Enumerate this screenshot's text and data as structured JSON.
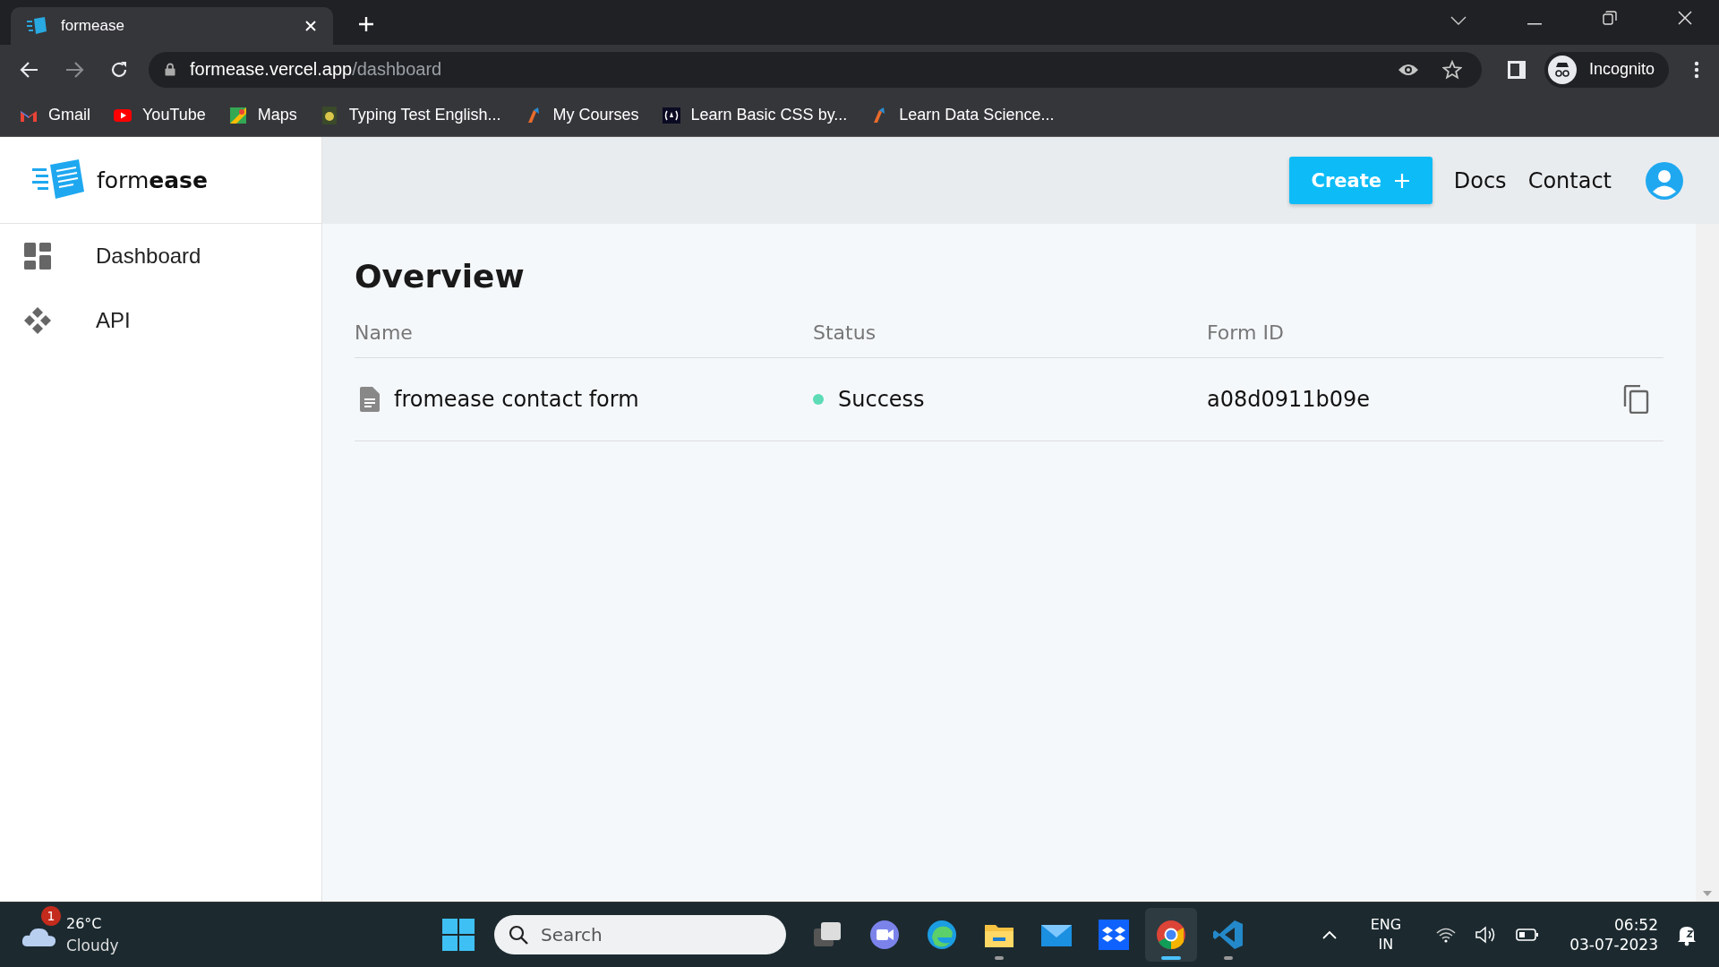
{
  "browser": {
    "tab": {
      "title": "formease"
    },
    "address": {
      "host": "formease.vercel.app",
      "path": "/dashboard"
    },
    "profile": "Incognito",
    "bookmarks": [
      "Gmail",
      "YouTube",
      "Maps",
      "Typing Test English...",
      "My Courses",
      "Learn Basic CSS by...",
      "Learn Data Science..."
    ]
  },
  "app": {
    "logo": {
      "light": "form",
      "bold": "ease"
    },
    "sidebar": {
      "items": [
        {
          "label": "Dashboard",
          "kind": "dashboard"
        },
        {
          "label": "API",
          "kind": "api"
        }
      ]
    },
    "header": {
      "create": "Create",
      "links": [
        "Docs",
        "Contact"
      ]
    },
    "title": "Overview",
    "table": {
      "columns": [
        "Name",
        "Status",
        "Form ID"
      ],
      "rows": [
        {
          "name": "fromease contact form",
          "status": "Success",
          "color": "#5ddbb6",
          "form_id": "a08d0911b09e"
        }
      ]
    }
  },
  "taskbar": {
    "weather": {
      "temp": "26°C",
      "cond": "Cloudy",
      "badge": "1"
    },
    "search": {
      "placeholder": "Search"
    },
    "apps": [
      {
        "kind": "taskview",
        "running": false,
        "selected": false
      },
      {
        "kind": "meet",
        "running": false,
        "selected": false
      },
      {
        "kind": "edge",
        "running": false,
        "selected": false
      },
      {
        "kind": "files",
        "running": true,
        "selected": false
      },
      {
        "kind": "mail",
        "running": false,
        "selected": false
      },
      {
        "kind": "dropbox",
        "running": false,
        "selected": false
      },
      {
        "kind": "chrome",
        "running": true,
        "selected": true
      },
      {
        "kind": "vscode",
        "running": true,
        "selected": false
      }
    ],
    "lang": [
      "ENG",
      "IN"
    ],
    "time": "06:52",
    "date": "03-07-2023"
  }
}
